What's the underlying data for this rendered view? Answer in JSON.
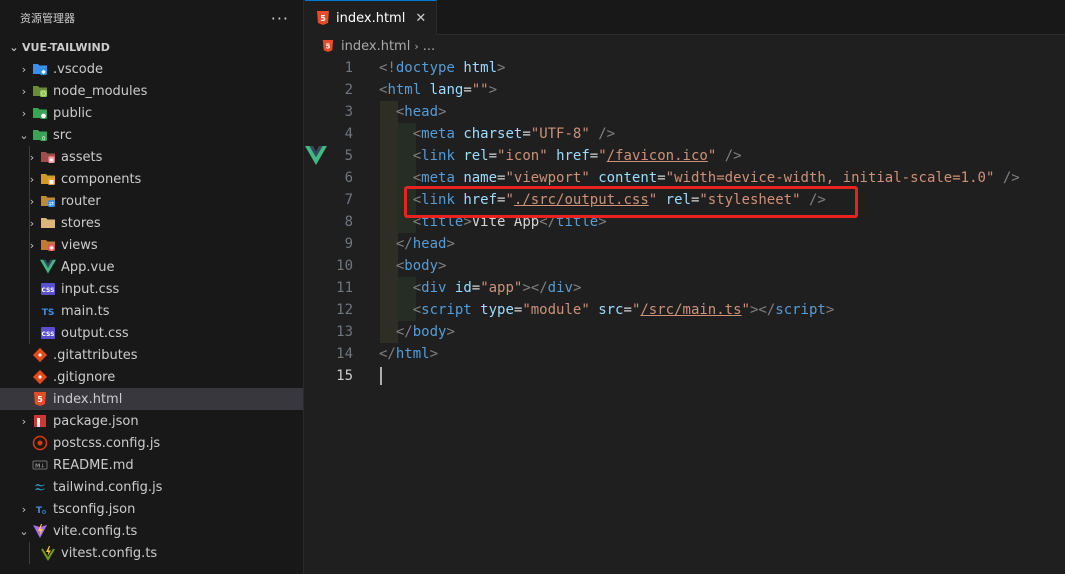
{
  "sidebar": {
    "title": "资源管理器",
    "more": "···",
    "root_label": "VUE-TAILWIND",
    "items": [
      {
        "label": ".vscode",
        "level": 0,
        "chevron": "›",
        "icon": "vscode-folder-icon"
      },
      {
        "label": "node_modules",
        "level": 0,
        "chevron": "›",
        "icon": "node-folder-icon"
      },
      {
        "label": "public",
        "level": 0,
        "chevron": "›",
        "icon": "public-folder-icon"
      },
      {
        "label": "src",
        "level": 0,
        "chevron": "⌄",
        "icon": "src-folder-icon"
      },
      {
        "label": "assets",
        "level": 1,
        "chevron": "›",
        "icon": "assets-folder-icon"
      },
      {
        "label": "components",
        "level": 1,
        "chevron": "›",
        "icon": "components-folder-icon"
      },
      {
        "label": "router",
        "level": 1,
        "chevron": "›",
        "icon": "router-folder-icon"
      },
      {
        "label": "stores",
        "level": 1,
        "chevron": "›",
        "icon": "stores-folder-icon"
      },
      {
        "label": "views",
        "level": 1,
        "chevron": "›",
        "icon": "views-folder-icon"
      },
      {
        "label": "App.vue",
        "level": 1,
        "chevron": "",
        "icon": "vue-file-icon"
      },
      {
        "label": "input.css",
        "level": 1,
        "chevron": "",
        "icon": "css-file-icon"
      },
      {
        "label": "main.ts",
        "level": 1,
        "chevron": "",
        "icon": "ts-file-icon"
      },
      {
        "label": "output.css",
        "level": 1,
        "chevron": "",
        "icon": "css-file-icon"
      },
      {
        "label": ".gitattributes",
        "level": 0,
        "chevron": "",
        "icon": "git-file-icon"
      },
      {
        "label": ".gitignore",
        "level": 0,
        "chevron": "",
        "icon": "git-file-icon"
      },
      {
        "label": "index.html",
        "level": 0,
        "chevron": "",
        "icon": "html-file-icon",
        "selected": true
      },
      {
        "label": "package.json",
        "level": 0,
        "chevron": "›",
        "icon": "npm-file-icon"
      },
      {
        "label": "postcss.config.js",
        "level": 0,
        "chevron": "",
        "icon": "postcss-file-icon"
      },
      {
        "label": "README.md",
        "level": 0,
        "chevron": "",
        "icon": "markdown-file-icon"
      },
      {
        "label": "tailwind.config.js",
        "level": 0,
        "chevron": "",
        "icon": "tailwind-file-icon"
      },
      {
        "label": "tsconfig.json",
        "level": 0,
        "chevron": "›",
        "icon": "tsconfig-file-icon"
      },
      {
        "label": "vite.config.ts",
        "level": 0,
        "chevron": "⌄",
        "icon": "vite-file-icon"
      },
      {
        "label": "vitest.config.ts",
        "level": 1,
        "chevron": "",
        "icon": "vitest-file-icon"
      }
    ]
  },
  "editor": {
    "tab_label": "index.html",
    "tab_close": "✕",
    "breadcrumb_file": "index.html",
    "breadcrumb_sep": "›",
    "breadcrumb_more": "...",
    "active_line": 15,
    "lines": [
      {
        "n": "1",
        "tokens": [
          [
            "punc",
            "<!"
          ],
          [
            "tag",
            "doctype"
          ],
          [
            "text",
            " "
          ],
          [
            "attr",
            "html"
          ],
          [
            "punc",
            ">"
          ]
        ]
      },
      {
        "n": "2",
        "tokens": [
          [
            "punc",
            "<"
          ],
          [
            "tag",
            "html"
          ],
          [
            "text",
            " "
          ],
          [
            "attr",
            "lang"
          ],
          [
            "text",
            "="
          ],
          [
            "str",
            "\"\""
          ],
          [
            "punc",
            ">"
          ]
        ]
      },
      {
        "n": "3",
        "tokens": [
          [
            "text",
            "  "
          ],
          [
            "punc",
            "<"
          ],
          [
            "tag",
            "head"
          ],
          [
            "punc",
            ">"
          ]
        ]
      },
      {
        "n": "4",
        "tokens": [
          [
            "text",
            "    "
          ],
          [
            "punc",
            "<"
          ],
          [
            "tag",
            "meta"
          ],
          [
            "text",
            " "
          ],
          [
            "attr",
            "charset"
          ],
          [
            "text",
            "="
          ],
          [
            "str",
            "\"UTF-8\""
          ],
          [
            "text",
            " "
          ],
          [
            "punc",
            "/>"
          ]
        ]
      },
      {
        "n": "5",
        "tokens": [
          [
            "text",
            "    "
          ],
          [
            "punc",
            "<"
          ],
          [
            "tag",
            "link"
          ],
          [
            "text",
            " "
          ],
          [
            "attr",
            "rel"
          ],
          [
            "text",
            "="
          ],
          [
            "str",
            "\"icon\""
          ],
          [
            "text",
            " "
          ],
          [
            "attr",
            "href"
          ],
          [
            "text",
            "="
          ],
          [
            "str",
            "\""
          ],
          [
            "strlink",
            "/favicon.ico"
          ],
          [
            "str",
            "\""
          ],
          [
            "text",
            " "
          ],
          [
            "punc",
            "/>"
          ]
        ]
      },
      {
        "n": "6",
        "tokens": [
          [
            "text",
            "    "
          ],
          [
            "punc",
            "<"
          ],
          [
            "tag",
            "meta"
          ],
          [
            "text",
            " "
          ],
          [
            "attr",
            "name"
          ],
          [
            "text",
            "="
          ],
          [
            "str",
            "\"viewport\""
          ],
          [
            "text",
            " "
          ],
          [
            "attr",
            "content"
          ],
          [
            "text",
            "="
          ],
          [
            "str",
            "\"width=device-width, initial-scale=1.0\""
          ],
          [
            "text",
            " "
          ],
          [
            "punc",
            "/>"
          ]
        ]
      },
      {
        "n": "7",
        "tokens": [
          [
            "text",
            "    "
          ],
          [
            "punc",
            "<"
          ],
          [
            "tag",
            "link"
          ],
          [
            "text",
            " "
          ],
          [
            "attr",
            "href"
          ],
          [
            "text",
            "="
          ],
          [
            "str",
            "\""
          ],
          [
            "strlink",
            "./src/output.css"
          ],
          [
            "str",
            "\""
          ],
          [
            "text",
            " "
          ],
          [
            "attr",
            "rel"
          ],
          [
            "text",
            "="
          ],
          [
            "str",
            "\"stylesheet\""
          ],
          [
            "text",
            " "
          ],
          [
            "punc",
            "/>"
          ]
        ]
      },
      {
        "n": "8",
        "tokens": [
          [
            "text",
            "    "
          ],
          [
            "punc",
            "<"
          ],
          [
            "tag",
            "title"
          ],
          [
            "punc",
            ">"
          ],
          [
            "text",
            "Vite App"
          ],
          [
            "punc",
            "</"
          ],
          [
            "tag",
            "title"
          ],
          [
            "punc",
            ">"
          ]
        ]
      },
      {
        "n": "9",
        "tokens": [
          [
            "text",
            "  "
          ],
          [
            "punc",
            "</"
          ],
          [
            "tag",
            "head"
          ],
          [
            "punc",
            ">"
          ]
        ]
      },
      {
        "n": "10",
        "tokens": [
          [
            "text",
            "  "
          ],
          [
            "punc",
            "<"
          ],
          [
            "tag",
            "body"
          ],
          [
            "punc",
            ">"
          ]
        ]
      },
      {
        "n": "11",
        "tokens": [
          [
            "text",
            "    "
          ],
          [
            "punc",
            "<"
          ],
          [
            "tag",
            "div"
          ],
          [
            "text",
            " "
          ],
          [
            "attr",
            "id"
          ],
          [
            "text",
            "="
          ],
          [
            "str",
            "\"app\""
          ],
          [
            "punc",
            "></"
          ],
          [
            "tag",
            "div"
          ],
          [
            "punc",
            ">"
          ]
        ]
      },
      {
        "n": "12",
        "tokens": [
          [
            "text",
            "    "
          ],
          [
            "punc",
            "<"
          ],
          [
            "tag",
            "script"
          ],
          [
            "text",
            " "
          ],
          [
            "attr",
            "type"
          ],
          [
            "text",
            "="
          ],
          [
            "str",
            "\"module\""
          ],
          [
            "text",
            " "
          ],
          [
            "attr",
            "src"
          ],
          [
            "text",
            "="
          ],
          [
            "str",
            "\""
          ],
          [
            "strlink",
            "/src/main.ts"
          ],
          [
            "str",
            "\""
          ],
          [
            "punc",
            "></"
          ],
          [
            "tag",
            "script"
          ],
          [
            "punc",
            ">"
          ]
        ]
      },
      {
        "n": "13",
        "tokens": [
          [
            "text",
            "  "
          ],
          [
            "punc",
            "</"
          ],
          [
            "tag",
            "body"
          ],
          [
            "punc",
            ">"
          ]
        ]
      },
      {
        "n": "14",
        "tokens": [
          [
            "punc",
            "</"
          ],
          [
            "tag",
            "html"
          ],
          [
            "punc",
            ">"
          ]
        ]
      },
      {
        "n": "15",
        "tokens": []
      }
    ]
  },
  "colors": {
    "highlight_box": "#e8231f",
    "vue_green": "#41b883",
    "html_orange": "#e44d26",
    "folder_yellow": "#dcb67a"
  }
}
